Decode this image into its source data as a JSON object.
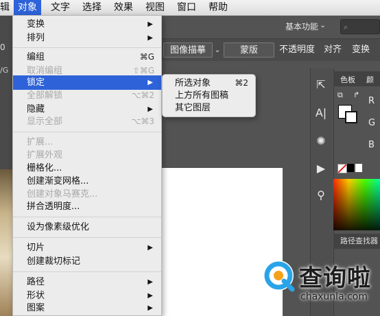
{
  "menubar": {
    "items": [
      "辑",
      "对象",
      "文字",
      "选择",
      "效果",
      "视图",
      "窗口",
      "帮助"
    ]
  },
  "workspace": {
    "label": "基本功能",
    "search_placeholder": ""
  },
  "control_bar": {
    "image_trace": "图像描摹",
    "mask": "蒙版",
    "opacity": "不透明度",
    "align": "对齐",
    "transform": "变换"
  },
  "left_fragments": {
    "text1": "0",
    "path": "/G"
  },
  "object_menu": {
    "items": [
      {
        "label": "变换",
        "submenu": true
      },
      {
        "label": "排列",
        "submenu": true
      },
      {
        "label": "编组",
        "shortcut": "⌘G"
      },
      {
        "label": "取消编组",
        "shortcut": "⇧⌘G",
        "disabled": true
      },
      {
        "label": "锁定",
        "submenu": true,
        "highlighted": true
      },
      {
        "label": "全部解锁",
        "shortcut": "⌥⌘2",
        "disabled": true
      },
      {
        "label": "隐藏",
        "submenu": true
      },
      {
        "label": "显示全部",
        "shortcut": "⌥⌘3",
        "disabled": true
      },
      {
        "label": "扩展...",
        "disabled": true
      },
      {
        "label": "扩展外观",
        "disabled": true
      },
      {
        "label": "栅格化..."
      },
      {
        "label": "创建渐变网格..."
      },
      {
        "label": "创建对象马赛克...",
        "disabled": true
      },
      {
        "label": "拼合透明度..."
      },
      {
        "label": "设为像素级优化"
      },
      {
        "label": "切片",
        "submenu": true
      },
      {
        "label": "创建裁切标记"
      },
      {
        "label": "路径",
        "submenu": true
      },
      {
        "label": "形状",
        "submenu": true
      },
      {
        "label": "图案",
        "submenu": true
      }
    ]
  },
  "lock_submenu": {
    "items": [
      {
        "label": "所选对象",
        "shortcut": "⌘2"
      },
      {
        "label": "上方所有图稿",
        "shortcut": ""
      },
      {
        "label": "其它图层",
        "shortcut": ""
      }
    ]
  },
  "color_panel": {
    "tab_color": "色板",
    "tab_other": "颜",
    "r": "R",
    "g": "G",
    "b": "B"
  },
  "pathfinder": "路径查找器",
  "watermark": {
    "name": "查询啦",
    "url": "chaxunla.com"
  },
  "colors": {
    "menu_highlight": "#2d62d8",
    "app_bg": "#535353"
  }
}
